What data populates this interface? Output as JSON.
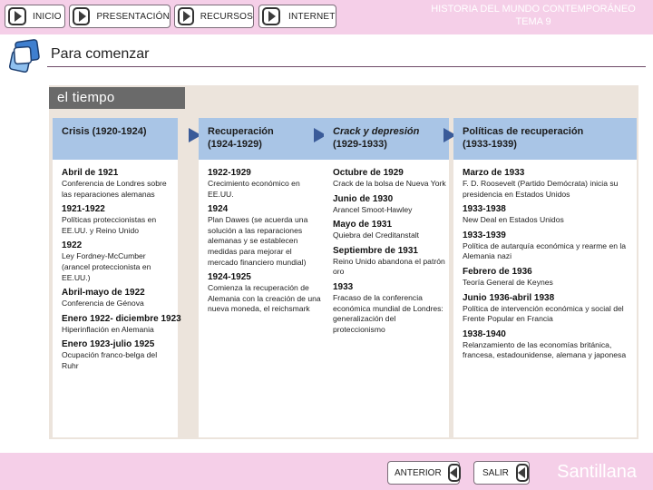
{
  "nav": {
    "inicio": "INICIO",
    "presentacion": "PRESENTACIÓN",
    "recursos": "RECURSOS",
    "internet": "INTERNET"
  },
  "header": {
    "title_line1": "HISTORIA DEL MUNDO CONTEMPORÁNEO",
    "title_line2": "TEMA 9"
  },
  "section": {
    "title": "Para comenzar"
  },
  "panel": {
    "tab_label": "el tiempo"
  },
  "columns": [
    {
      "header_line1": "Crisis (1920-1924)",
      "header_line2": "",
      "events": [
        {
          "date": "Abril de 1921",
          "desc": "Conferencia de Londres sobre las reparaciones alemanas"
        },
        {
          "date": "1921-1922",
          "desc": "Políticas proteccionistas en EE.UU. y Reino Unido"
        },
        {
          "date": "1922",
          "desc": "Ley Fordney-McCumber (arancel proteccionista en EE.UU.)"
        },
        {
          "date": "Abril-mayo de 1922",
          "desc": "Conferencia de Génova"
        },
        {
          "date": "Enero 1922- diciembre 1923",
          "desc": "Hiperinflación en Alemania"
        },
        {
          "date": "Enero 1923-julio 1925",
          "desc": "Ocupación franco-belga del Ruhr"
        }
      ]
    },
    {
      "header_line1": "Recuperación",
      "header_line2": "(1924-1929)",
      "events": [
        {
          "date": "1922-1929",
          "desc": "Crecimiento económico en EE.UU."
        },
        {
          "date": "1924",
          "desc": "Plan Dawes (se acuerda una solución a las reparaciones alemanas y se establecen medidas para mejorar el mercado financiero mundial)"
        },
        {
          "date": "1924-1925",
          "desc": "Comienza la recuperación de Alemania con la creación de una nueva moneda, el reichsmark"
        }
      ]
    },
    {
      "header_line1": "Crack y depresión",
      "header_line2": "(1929-1933)",
      "events": [
        {
          "date": "Octubre de 1929",
          "desc": "Crack de la bolsa de Nueva York"
        },
        {
          "date": "Junio de 1930",
          "desc": "Arancel Smoot-Hawley"
        },
        {
          "date": "Mayo de 1931",
          "desc": "Quiebra del Creditanstalt"
        },
        {
          "date": "Septiembre de 1931",
          "desc": "Reino Unido abandona el patrón oro"
        },
        {
          "date": "1933",
          "desc": "Fracaso de la conferencia económica mundial de Londres: generalización del proteccionismo"
        }
      ]
    },
    {
      "header_line1": "Políticas de recuperación",
      "header_line2": "(1933-1939)",
      "events": [
        {
          "date": "Marzo de 1933",
          "desc": "F. D. Roosevelt (Partido Demócrata) inicia su presidencia en Estados Unidos"
        },
        {
          "date": "1933-1938",
          "desc": "New Deal en Estados Unidos"
        },
        {
          "date": "1933-1939",
          "desc": "Política de autarquía económica y rearme en la Alemania nazi"
        },
        {
          "date": "Febrero de 1936",
          "desc": "Teoría General de Keynes"
        },
        {
          "date": "Junio 1936-abril 1938",
          "desc": "Política de intervención económica y social del Frente Popular en Francia"
        },
        {
          "date": "1938-1940",
          "desc": "Relanzamiento de las economías británica, francesa, estadounidense, alemana y japonesa"
        }
      ]
    }
  ],
  "footer": {
    "anterior": "ANTERIOR",
    "salir": "SALIR",
    "brand": "Santillana"
  },
  "colors": {
    "bar_pink": "#f5cfe8",
    "column_header_blue": "#a9c5e6",
    "arrow_blue": "#3a5b99",
    "panel_beige": "#ece4dc"
  },
  "icons": [
    "play-icon",
    "back-play-icon",
    "section-icon"
  ]
}
